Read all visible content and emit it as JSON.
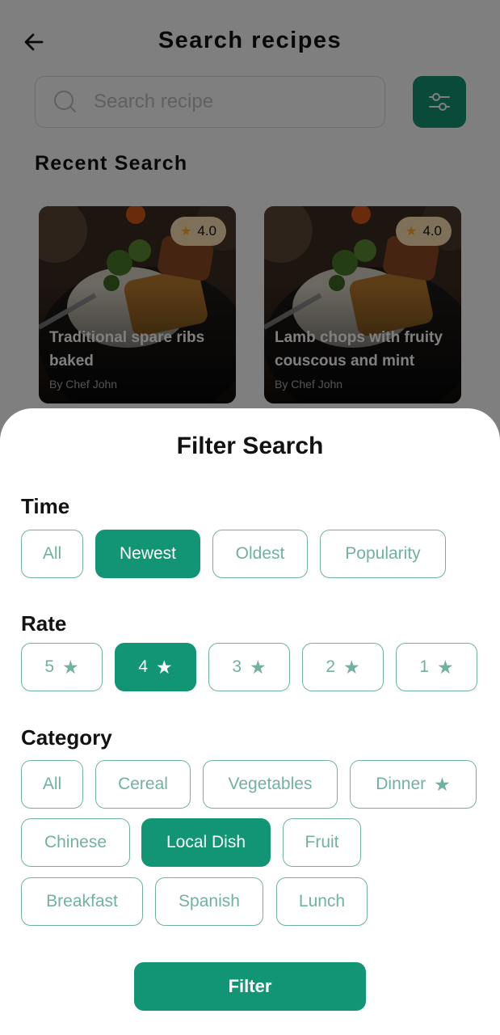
{
  "header": {
    "title": "Search recipes"
  },
  "search": {
    "placeholder": "Search recipe"
  },
  "recent": {
    "title": "Recent Search",
    "cards": [
      {
        "title": "Traditional spare ribs baked",
        "author": "By Chef John",
        "rating": "4.0"
      },
      {
        "title": "Lamb chops with fruity couscous and mint",
        "author": "By Chef John",
        "rating": "4.0"
      }
    ]
  },
  "filter": {
    "title": "Filter Search",
    "time": {
      "label": "Time",
      "options": [
        "All",
        "Newest",
        "Oldest",
        "Popularity"
      ],
      "selected": "Newest"
    },
    "rate": {
      "label": "Rate",
      "options": [
        "5",
        "4",
        "3",
        "2",
        "1"
      ],
      "selected": "4"
    },
    "category": {
      "label": "Category",
      "options": [
        "All",
        "Cereal",
        "Vegetables",
        "Dinner",
        "Chinese",
        "Local Dish",
        "Fruit",
        "Breakfast",
        "Spanish",
        "Lunch"
      ],
      "selected": "Local Dish"
    },
    "apply_label": "Filter"
  },
  "icons": {
    "back": "arrow-left-icon",
    "search": "search-icon",
    "filter": "sliders-icon",
    "star": "star-icon"
  },
  "colors": {
    "primary": "#129575",
    "chip_border": "#71b1a1",
    "rating_bg": "#ffe1b3",
    "rating_star": "#ffad30"
  }
}
